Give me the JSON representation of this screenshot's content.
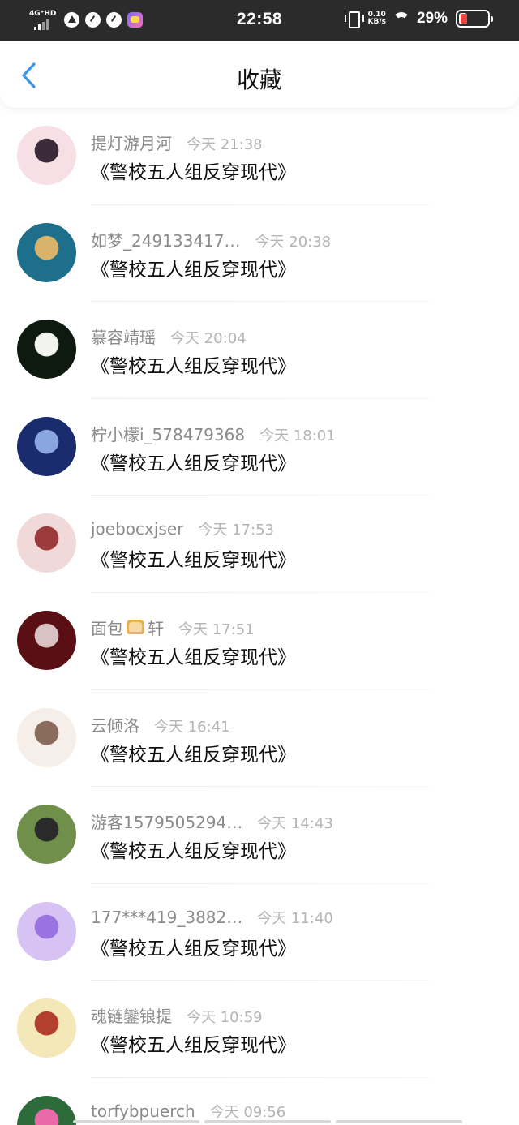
{
  "status_bar": {
    "network": "4G⁺HD",
    "time": "22:58",
    "speed_value": "0.10",
    "speed_unit": "KB/s",
    "battery_percent": "29%",
    "battery_level": 0.29,
    "icons": [
      "signal-icon",
      "location-icon",
      "gauge-icon",
      "gauge-icon",
      "app-icon",
      "vibrate-icon",
      "wifi-icon",
      "battery-icon"
    ]
  },
  "header": {
    "title": "收藏",
    "back_icon": "chevron-left-icon",
    "accent_color": "#3b95e6"
  },
  "items": [
    {
      "name": "提灯游月河",
      "time": "今天 21:38",
      "book": "《警校五人组反穿现代》",
      "avatar_colors": [
        "#f7dfe6",
        "#3a2a3a"
      ]
    },
    {
      "name": "如梦_249133417…",
      "time": "今天 20:38",
      "book": "《警校五人组反穿现代》",
      "avatar_colors": [
        "#1d6f8c",
        "#d9b36a"
      ]
    },
    {
      "name": "慕容靖瑶",
      "time": "今天 20:04",
      "book": "《警校五人组反穿现代》",
      "avatar_colors": [
        "#0e1a10",
        "#f2f2ee"
      ]
    },
    {
      "name": "柠小檬i_578479368",
      "time": "今天 18:01",
      "book": "《警校五人组反穿现代》",
      "avatar_colors": [
        "#1a2c6e",
        "#8aa6e0"
      ]
    },
    {
      "name": "joebocxjser",
      "time": "今天 17:53",
      "book": "《警校五人组反穿现代》",
      "avatar_colors": [
        "#f1d9d9",
        "#9b3a3a"
      ]
    },
    {
      "name": "面包",
      "name_suffix": "轩",
      "time": "今天 17:51",
      "book": "《警校五人组反穿现代》",
      "avatar_colors": [
        "#5a0f14",
        "#d8c2c2"
      ]
    },
    {
      "name": "云倾洛",
      "time": "今天 16:41",
      "book": "《警校五人组反穿现代》",
      "avatar_colors": [
        "#f6eee8",
        "#8a6b5c"
      ]
    },
    {
      "name": "游客1579505294…",
      "time": "今天 14:43",
      "book": "《警校五人组反穿现代》",
      "avatar_colors": [
        "#6f8f4a",
        "#2a2a2a"
      ]
    },
    {
      "name": "177***419_3882…",
      "time": "今天 11:40",
      "book": "《警校五人组反穿现代》",
      "avatar_colors": [
        "#d7c3f3",
        "#9a73e0"
      ]
    },
    {
      "name": "魂链鑾锒提",
      "time": "今天 10:59",
      "book": "《警校五人组反穿现代》",
      "avatar_colors": [
        "#f4e7b8",
        "#b3402e"
      ]
    },
    {
      "name": "torfybpuerch",
      "time": "今天 09:56",
      "book": "",
      "avatar_colors": [
        "#2d6b3a",
        "#e86aa8"
      ]
    }
  ]
}
